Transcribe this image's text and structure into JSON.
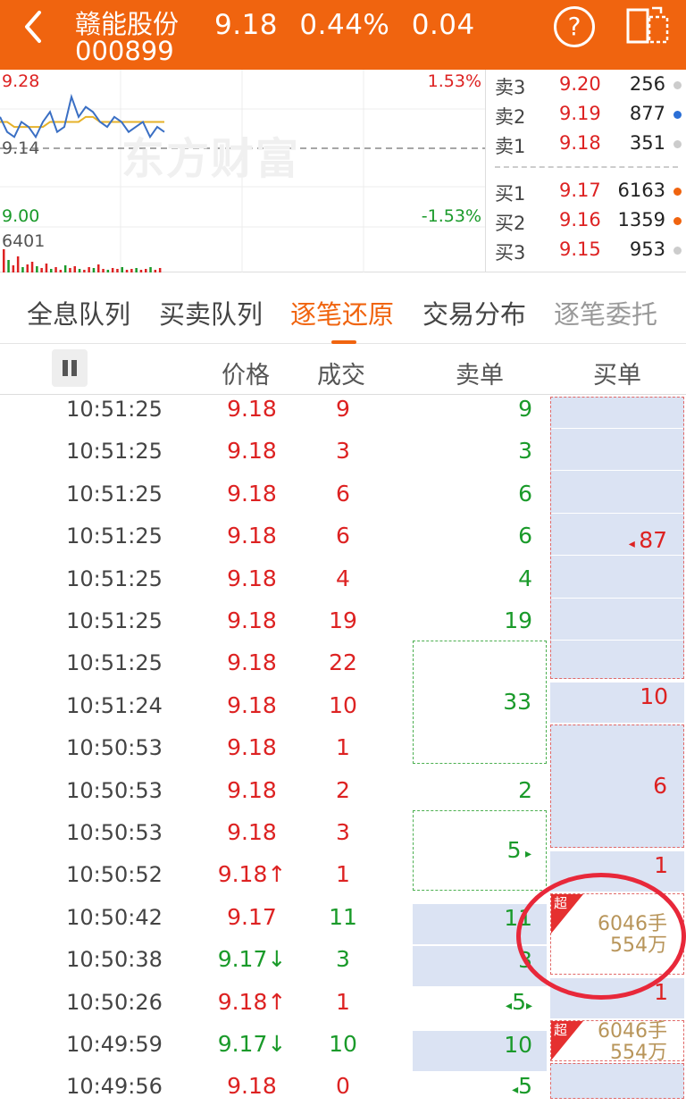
{
  "header": {
    "name": "赣能股份",
    "code": "000899",
    "price": "9.18",
    "change_pct": "0.44%",
    "change": "0.04",
    "help_symbol": "?"
  },
  "chart": {
    "high": "9.28",
    "low": "9.00",
    "prev_close": "9.14",
    "up_pct": "1.53%",
    "down_pct": "-1.53%",
    "volume": "6401",
    "watermark": "东方财富",
    "price_series": [
      9.2,
      9.17,
      9.16,
      9.19,
      9.18,
      9.16,
      9.19,
      9.21,
      9.17,
      9.18,
      9.24,
      9.2,
      9.22,
      9.21,
      9.19,
      9.18,
      9.2,
      9.19,
      9.17,
      9.18,
      9.19,
      9.16,
      9.18,
      9.17
    ],
    "avg_series": [
      9.19,
      9.19,
      9.18,
      9.18,
      9.18,
      9.18,
      9.18,
      9.19,
      9.19,
      9.19,
      9.19,
      9.19,
      9.2,
      9.2,
      9.19,
      9.19,
      9.19,
      9.19,
      9.19,
      9.19,
      9.19,
      9.19,
      9.19,
      9.19
    ]
  },
  "orderbook": {
    "asks": [
      {
        "label": "卖3",
        "price": "9.20",
        "vol": "256",
        "dot": "#cccccc"
      },
      {
        "label": "卖2",
        "price": "9.19",
        "vol": "877",
        "dot": "#2b6fd6"
      },
      {
        "label": "卖1",
        "price": "9.18",
        "vol": "351",
        "dot": "#cccccc"
      }
    ],
    "bids": [
      {
        "label": "买1",
        "price": "9.17",
        "vol": "6163",
        "dot": "#f0640f"
      },
      {
        "label": "买2",
        "price": "9.16",
        "vol": "1359",
        "dot": "#f0640f"
      },
      {
        "label": "买3",
        "price": "9.15",
        "vol": "953",
        "dot": "#cccccc"
      }
    ]
  },
  "tabs": [
    "全息队列",
    "买卖队列",
    "逐笔还原",
    "交易分布",
    "逐笔委托"
  ],
  "active_tab": "逐笔还原",
  "table_headers": {
    "price": "价格",
    "volume": "成交",
    "sell": "卖单",
    "buy": "买单"
  },
  "rows": [
    {
      "time": "10:51:25",
      "price": "9.18",
      "vol": "9",
      "vol_color": "red",
      "sell": "9"
    },
    {
      "time": "10:51:25",
      "price": "9.18",
      "vol": "3",
      "vol_color": "red",
      "sell": "3"
    },
    {
      "time": "10:51:25",
      "price": "9.18",
      "vol": "6",
      "vol_color": "red",
      "sell": "6"
    },
    {
      "time": "10:51:25",
      "price": "9.18",
      "vol": "6",
      "vol_color": "red",
      "sell": "6"
    },
    {
      "time": "10:51:25",
      "price": "9.18",
      "vol": "4",
      "vol_color": "red",
      "sell": "4"
    },
    {
      "time": "10:51:25",
      "price": "9.18",
      "vol": "19",
      "vol_color": "red",
      "sell": "19"
    },
    {
      "time": "10:51:25",
      "price": "9.18",
      "vol": "22",
      "vol_color": "red",
      "sell": ""
    },
    {
      "time": "10:51:24",
      "price": "9.18",
      "vol": "10",
      "vol_color": "red",
      "sell": "33"
    },
    {
      "time": "10:50:53",
      "price": "9.18",
      "vol": "1",
      "vol_color": "red",
      "sell": ""
    },
    {
      "time": "10:50:53",
      "price": "9.18",
      "vol": "2",
      "vol_color": "red",
      "sell": "2"
    },
    {
      "time": "10:50:53",
      "price": "9.18",
      "vol": "3",
      "vol_color": "red",
      "sell": ""
    },
    {
      "time": "10:50:52",
      "price": "9.18↑",
      "vol": "1",
      "vol_color": "red",
      "sell": "5"
    },
    {
      "time": "10:50:42",
      "price": "9.17",
      "vol": "11",
      "vol_color": "green",
      "sell": "11"
    },
    {
      "time": "10:50:38",
      "price": "9.17↓",
      "vol": "3",
      "vol_color": "green",
      "sell": "3"
    },
    {
      "time": "10:50:26",
      "price": "9.18↑",
      "vol": "1",
      "vol_color": "red",
      "sell": "5"
    },
    {
      "time": "10:49:59",
      "price": "9.17↓",
      "vol": "10",
      "vol_color": "green",
      "sell": "10"
    },
    {
      "time": "10:49:56",
      "price": "9.18",
      "vol": "0",
      "vol_color": "red",
      "sell": "5"
    }
  ],
  "buy_cells": {
    "b87": "87",
    "b10": "10",
    "b6": "6",
    "b1": "1",
    "b1b": "1",
    "super_label": "超",
    "big_shares": "6046手",
    "big_amount": "554万"
  }
}
